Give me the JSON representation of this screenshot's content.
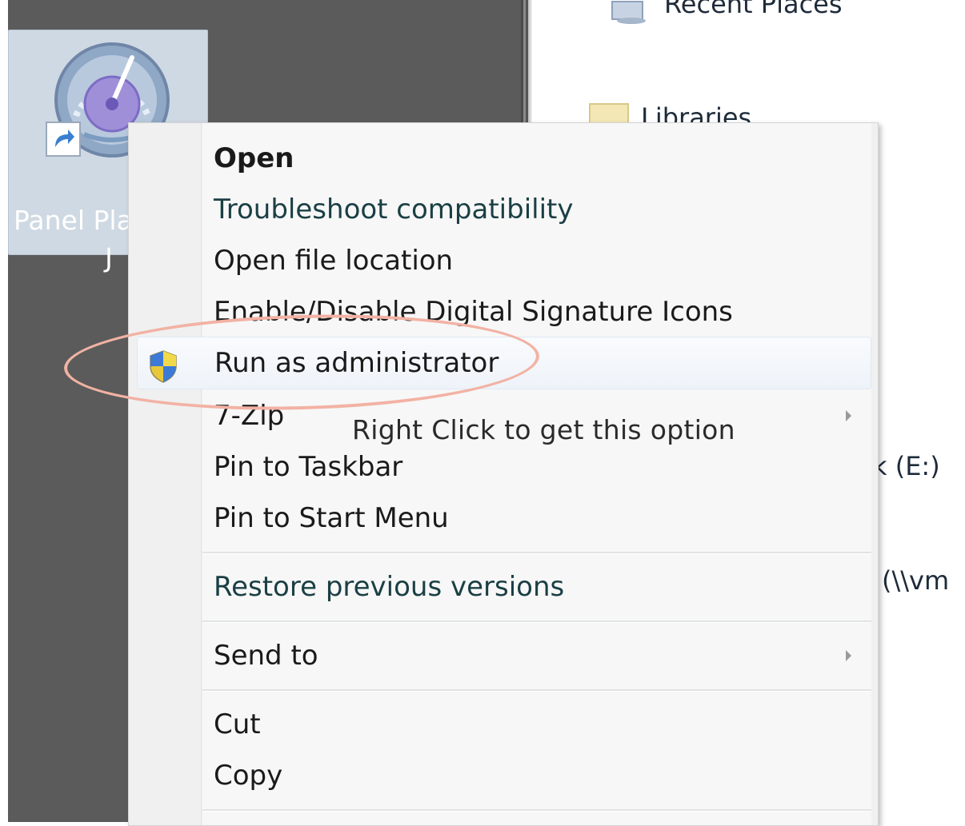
{
  "desktop": {
    "icon": {
      "label_line1": "Panel Pla",
      "label_line2": "J",
      "icon_name": "speedometer-shortcut-icon"
    }
  },
  "explorer": {
    "nav": {
      "recent_places": "Recent Places",
      "libraries": "Libraries",
      "drive_e_partial": "k (E:)",
      "network_partial": "(\\\\vm"
    }
  },
  "context_menu": {
    "items": [
      {
        "label": "Open",
        "bold": true
      },
      {
        "label": "Troubleshoot compatibility"
      },
      {
        "label": "Open file location"
      },
      {
        "label": "Enable/Disable Digital Signature Icons"
      },
      {
        "label": "Run as administrator",
        "icon": "uac-shield-icon",
        "highlighted": true
      },
      {
        "label": "7-Zip",
        "submenu": true
      },
      {
        "label": "Pin to Taskbar"
      },
      {
        "label": "Pin to Start Menu"
      },
      {
        "label": "Restore previous versions"
      },
      {
        "label": "Send to",
        "submenu": true
      },
      {
        "label": "Cut"
      },
      {
        "label": "Copy"
      }
    ]
  },
  "annotation": {
    "text": "Right Click to get this option",
    "color": "#f2b2a4"
  }
}
